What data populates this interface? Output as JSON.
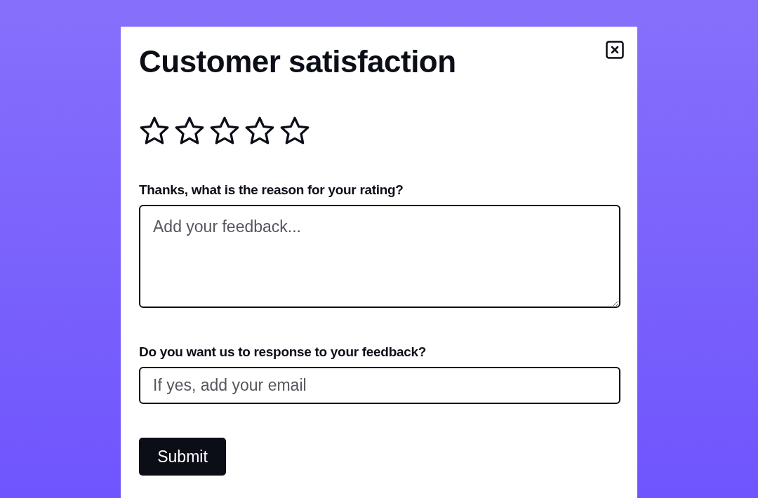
{
  "dialog": {
    "title": "Customer satisfaction",
    "rating": {
      "stars": 0
    },
    "feedback": {
      "label": "Thanks, what is the reason for your rating?",
      "placeholder": "Add your feedback..."
    },
    "email": {
      "label": "Do you want us to response to your feedback?",
      "placeholder": "If yes, add your email"
    },
    "submit": "Submit"
  }
}
